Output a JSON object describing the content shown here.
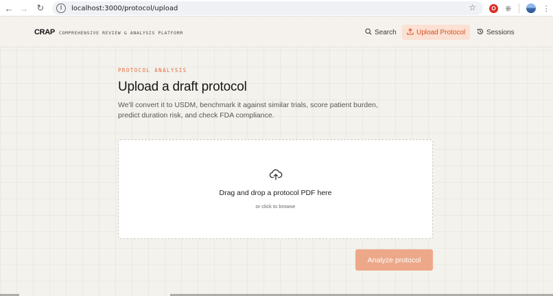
{
  "browser": {
    "url": "localhost:3000/protocol/upload",
    "icons": {
      "back": "arrow-left-icon",
      "forward": "arrow-right-icon",
      "reload": "reload-icon",
      "site_info": "info-icon",
      "bookmark": "star-icon",
      "extension": "opera-extension-icon",
      "extensions_menu": "puzzle-icon",
      "profile": "avatar-icon",
      "menu": "kebab-menu-icon"
    }
  },
  "header": {
    "brand": "CRAP",
    "brand_subtitle": "COMPREHENSIVE REVIEW & ANALYSIS PLATFORM",
    "nav": [
      {
        "label": "Search",
        "icon": "search-icon"
      },
      {
        "label": "Upload Protocol",
        "icon": "upload-icon",
        "active": true
      },
      {
        "label": "Sessions",
        "icon": "history-icon"
      }
    ]
  },
  "main": {
    "eyebrow": "PROTOCOL ANALYSIS",
    "title": "Upload a draft protocol",
    "subtitle": "We'll convert it to USDM, benchmark it against similar trials, score patient burden, predict duration risk, and check FDA compliance.",
    "dropzone": {
      "icon": "cloud-upload-icon",
      "title": "Drag and drop a protocol PDF here",
      "subtitle": "or click to browse"
    },
    "analyze_label": "Analyze protocol"
  },
  "colors": {
    "accent": "#e0693a",
    "accent_soft": "#fbe0d3",
    "button_disabled": "#eda88a",
    "background": "#f4f2ed"
  }
}
